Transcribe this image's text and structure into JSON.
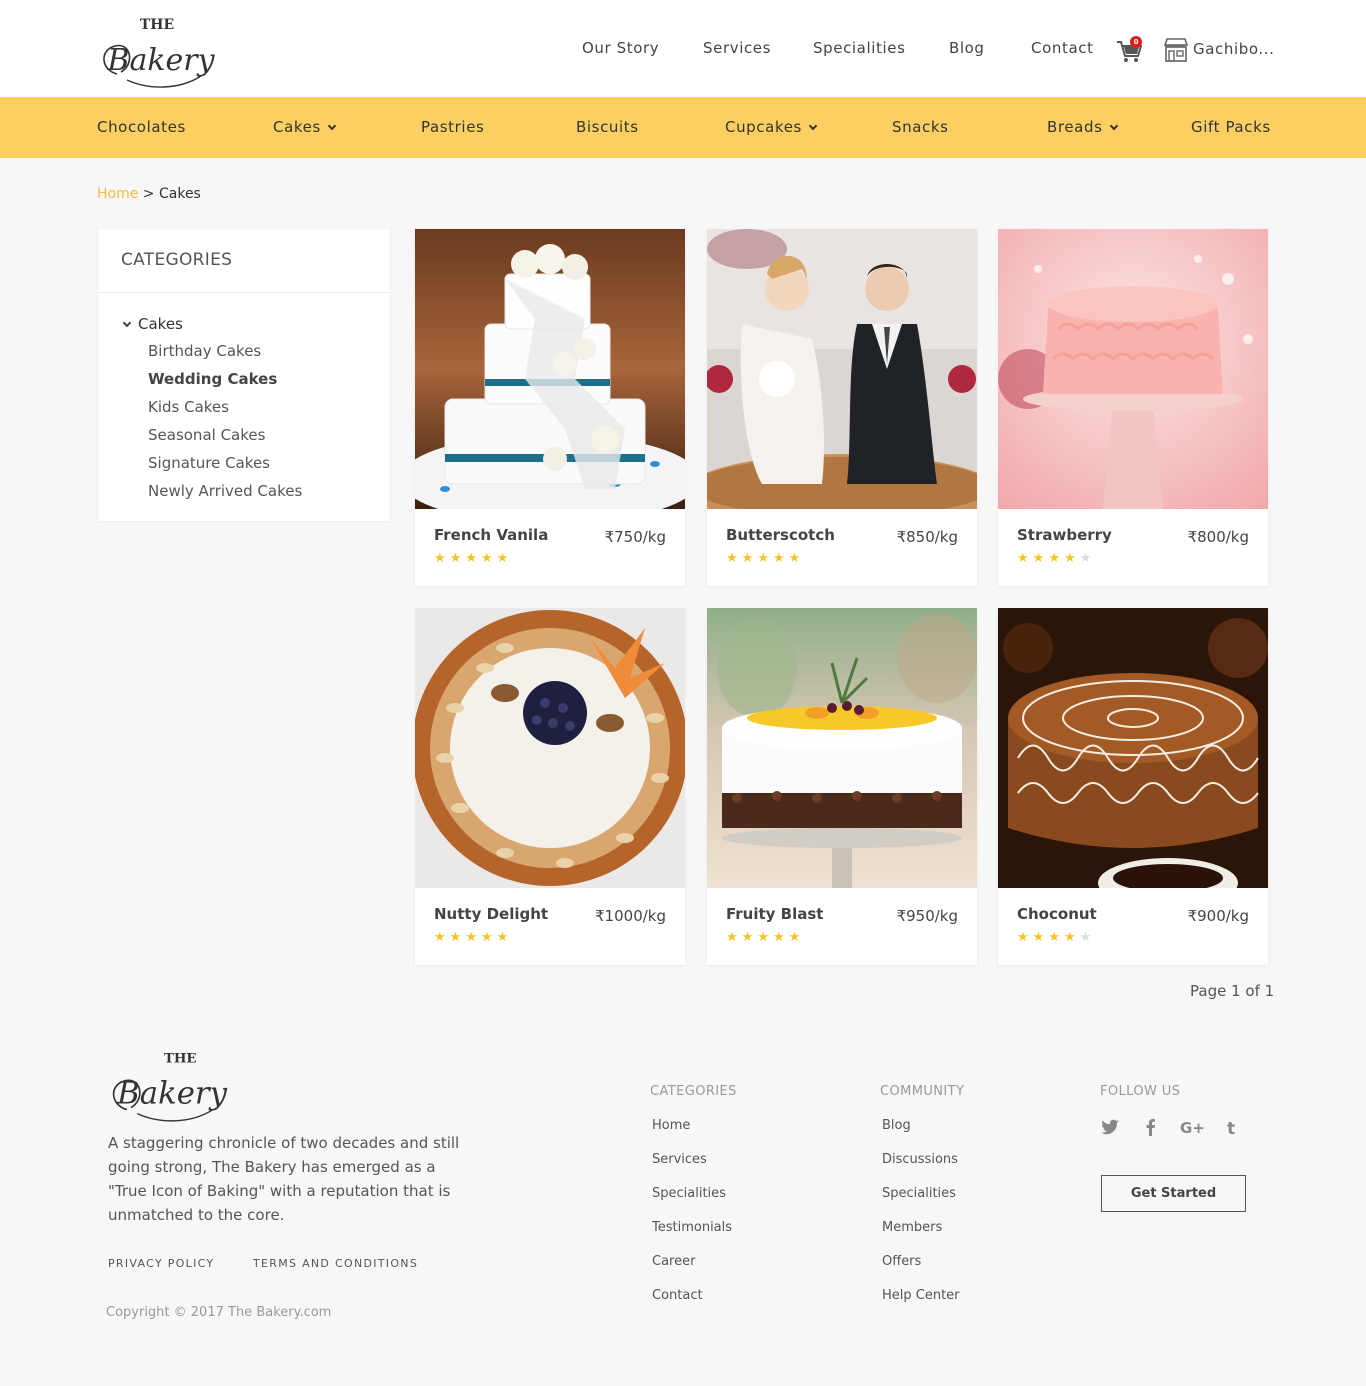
{
  "header": {
    "logo_top": "THE",
    "logo_main": "Bakery",
    "nav": [
      "Our Story",
      "Services",
      "Specialities",
      "Blog",
      "Contact"
    ],
    "cart_count": "0",
    "location": "Gachibo..."
  },
  "catbar": {
    "items": [
      "Chocolates",
      "Cakes",
      "Pastries",
      "Biscuits",
      "Cupcakes",
      "Snacks",
      "Breads",
      "Gift Packs"
    ]
  },
  "breadcrumb": {
    "home": "Home",
    "separator": " > ",
    "current": "Cakes"
  },
  "sidebar": {
    "title": "CATEGORIES",
    "parent": "Cakes",
    "items": [
      "Birthday Cakes",
      "Wedding Cakes",
      "Kids Cakes",
      "Seasonal Cakes",
      "Signature Cakes",
      "Newly Arrived Cakes"
    ]
  },
  "products": [
    {
      "name": "French Vanila",
      "price": "₹750/kg",
      "rating": 5
    },
    {
      "name": "Butterscotch",
      "price": "₹850/kg",
      "rating": 5
    },
    {
      "name": "Strawberry",
      "price": "₹800/kg",
      "rating": 4
    },
    {
      "name": "Nutty Delight",
      "price": "₹1000/kg",
      "rating": 5
    },
    {
      "name": "Fruity Blast",
      "price": "₹950/kg",
      "rating": 5
    },
    {
      "name": "Choconut",
      "price": "₹900/kg",
      "rating": 4
    }
  ],
  "pagination": {
    "text": "Page 1 of 1"
  },
  "footer": {
    "logo_top": "THE",
    "logo_main": "Bakery",
    "description": "A staggering chronicle of two decades and still going strong, The Bakery has emerged as a \"True Icon of Baking\" with a reputation that is unmatched to the core.",
    "privacy": "PRIVACY POLICY",
    "terms": "TERMS AND CONDITIONS",
    "copyright": "Copyright © 2017 The Bakery.com",
    "categories_title": "CATEGORIES",
    "categories": [
      "Home",
      "Services",
      "Specialities",
      "Testimonials",
      "Career",
      "Contact"
    ],
    "community_title": "COMMUNITY",
    "community": [
      "Blog",
      "Discussions",
      "Specialities",
      "Members",
      "Offers",
      "Help Center"
    ],
    "follow_title": "FOLLOW US",
    "social": [
      "twitter-icon",
      "facebook-icon",
      "google-plus-icon",
      "tumblr-icon"
    ],
    "cta": "Get Started"
  },
  "colors": {
    "accent": "#fccf63",
    "link": "#f4b941",
    "star": "#f7c325",
    "badge": "#d62020"
  }
}
